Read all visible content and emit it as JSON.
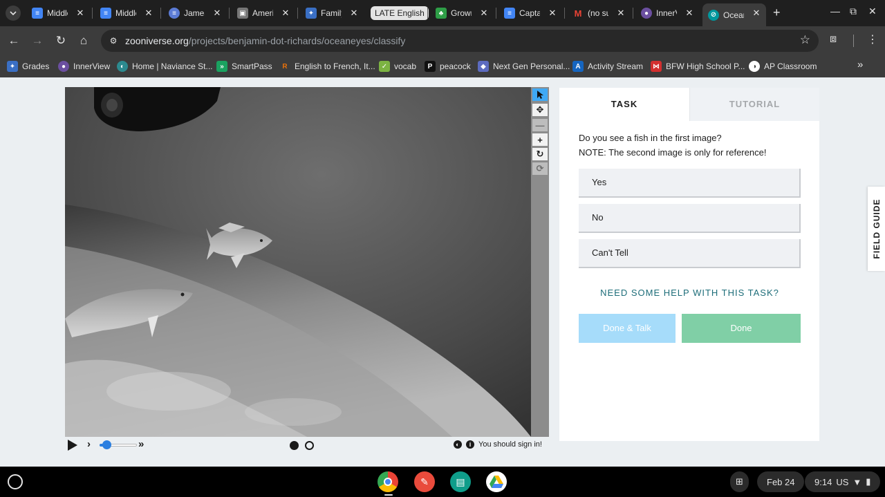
{
  "browser": {
    "tabs": [
      {
        "title": "Middle",
        "favicon": "docs-icon",
        "color": "#4285f4"
      },
      {
        "title": "Middle",
        "favicon": "docs-icon",
        "color": "#4285f4"
      },
      {
        "title": "James",
        "favicon": "globe-icon",
        "color": "#5b7bd5"
      },
      {
        "title": "Ameri",
        "favicon": "flag-icon",
        "color": "#777777"
      },
      {
        "title": "Family",
        "favicon": "network-icon",
        "color": "#3a6fc4"
      },
      {
        "title": "Grown",
        "favicon": "tree-icon",
        "color": "#2e9e47"
      },
      {
        "title": "Capta",
        "favicon": "docs-icon",
        "color": "#4285f4"
      },
      {
        "title": "(no su",
        "favicon": "gmail-icon",
        "color": "#ea4335"
      },
      {
        "title": "InnerV",
        "favicon": "innerview-icon",
        "color": "#6b4fa0"
      },
      {
        "title": "Ocean",
        "favicon": "zooniverse-icon",
        "color": "#00979d"
      }
    ],
    "tab_group_label": "LATE English",
    "new_tab_label": "+",
    "url_host": "zooniverse.org",
    "url_path": "/projects/benjamin-dot-richards/oceaneyes/classify",
    "bookmarks": [
      {
        "label": "Grades",
        "color": "#3a6fc4"
      },
      {
        "label": "InnerView",
        "color": "#6b4fa0"
      },
      {
        "label": "Home | Naviance St...",
        "color": "#2c8a8f"
      },
      {
        "label": "SmartPass",
        "color": "#1aa260"
      },
      {
        "label": "English to French, It...",
        "color": "#e8710a"
      },
      {
        "label": "vocab",
        "color": "#7cb342"
      },
      {
        "label": "peacock",
        "color": "#111111"
      },
      {
        "label": "Next Gen Personal...",
        "color": "#5c6bc0"
      },
      {
        "label": "Activity Stream",
        "color": "#1565c0"
      },
      {
        "label": "BFW High School P...",
        "color": "#d32f2f"
      },
      {
        "label": "AP Classroom",
        "color": "#ffffff"
      }
    ]
  },
  "viewer": {
    "tools": [
      "pointer-icon",
      "move-icon",
      "zoom-out-icon",
      "zoom-in-icon",
      "rotate-icon",
      "reset-icon"
    ],
    "frames_total": 2,
    "current_frame": 1,
    "signin_text": "You should sign in!"
  },
  "task_panel": {
    "tab_task": "TASK",
    "tab_tutorial": "TUTORIAL",
    "question_line1": "Do you see a fish in the first image?",
    "question_line2": "NOTE: The second image is only for reference!",
    "answers": [
      "Yes",
      "No",
      "Can't Tell"
    ],
    "help_link": "NEED SOME HELP WITH THIS TASK?",
    "done_talk_label": "Done & Talk",
    "done_label": "Done"
  },
  "field_guide_label": "FIELD GUIDE",
  "shelf": {
    "date": "Feb 24",
    "time": "9:14",
    "locale": "US"
  }
}
